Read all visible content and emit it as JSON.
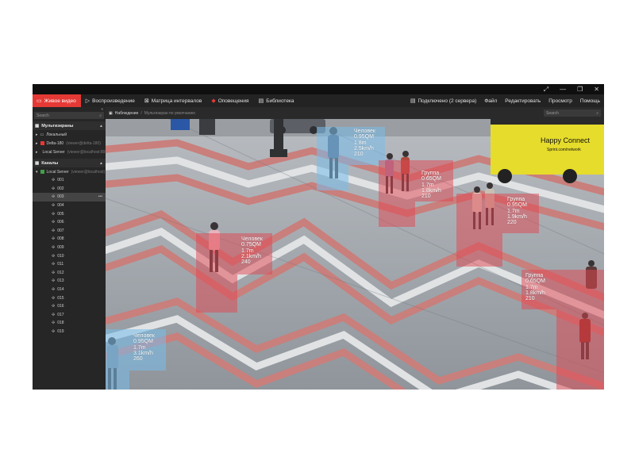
{
  "window": {
    "controls": [
      "⤢",
      "—",
      "❐",
      "✕"
    ]
  },
  "toolbar": {
    "tabs": [
      {
        "label": "Живое видео",
        "icon": "monitor-icon",
        "active": true
      },
      {
        "label": "Воспроизведение",
        "icon": "play-icon"
      },
      {
        "label": "Матрица интервалов",
        "icon": "matrix-icon"
      },
      {
        "label": "Оповещения",
        "icon": "bell-icon"
      },
      {
        "label": "Библиотека",
        "icon": "library-icon"
      }
    ],
    "connection": "Подключено (2 сервера)",
    "menu": [
      "Файл",
      "Редактировать",
      "Просмотр",
      "Помощь"
    ]
  },
  "sidebar": {
    "search_placeholder": "Search",
    "collapse": "«",
    "sections": {
      "multiscreens": "Мультиэкраны",
      "channels": "Каналы"
    },
    "multiscreen_items": [
      {
        "label": "Локальный",
        "sub": ""
      },
      {
        "label": "Delta-180",
        "sub": "(viewer@delta-180)"
      },
      {
        "label": "Local Server",
        "sub": "(viewer@localhost:8000)"
      }
    ],
    "channel_server": {
      "label": "Local Server",
      "sub": "(viewer@localhost)"
    },
    "channels": [
      "001",
      "002",
      "003",
      "004",
      "005",
      "006",
      "007",
      "008",
      "009",
      "010",
      "011",
      "012",
      "013",
      "014",
      "015",
      "016",
      "017",
      "018",
      "019"
    ],
    "selected_channel": "003"
  },
  "view": {
    "crumb": "Наблюдение",
    "crumb2": "Мультиэкран по умолчанию",
    "search_placeholder": "Search"
  },
  "detections": [
    {
      "type": "Человек",
      "line1": "0.95QM",
      "line2": "1.8m",
      "line3": "2.5km/h",
      "line4": "210",
      "color": "blue"
    },
    {
      "type": "Группа",
      "line1": "0.65QM",
      "line2": "1.7m",
      "line3": "1.8km/h",
      "line4": "210",
      "color": "red"
    },
    {
      "type": "Группа",
      "line1": "0.95QM",
      "line2": "1.7m",
      "line3": "1.9km/h",
      "line4": "220",
      "color": "red"
    },
    {
      "type": "Человек",
      "line1": "0.75QM",
      "line2": "1.7m",
      "line3": "2.1km/h",
      "line4": "240",
      "color": "red"
    },
    {
      "type": "Группа",
      "line1": "0.65QM",
      "line2": "1.7m",
      "line3": "1.8km/h",
      "line4": "210",
      "color": "red"
    },
    {
      "type": "Человек",
      "line1": "0.95QM",
      "line2": "1.7m",
      "line3": "3.1km/h",
      "line4": "260",
      "color": "blue"
    }
  ],
  "bus_sign": {
    "line1": "Happy Connect",
    "line2": "Sprint.com/network"
  },
  "colors": {
    "active_tab": "#e53935",
    "box_blue": "#78bee b",
    "box_red": "#e14650"
  }
}
